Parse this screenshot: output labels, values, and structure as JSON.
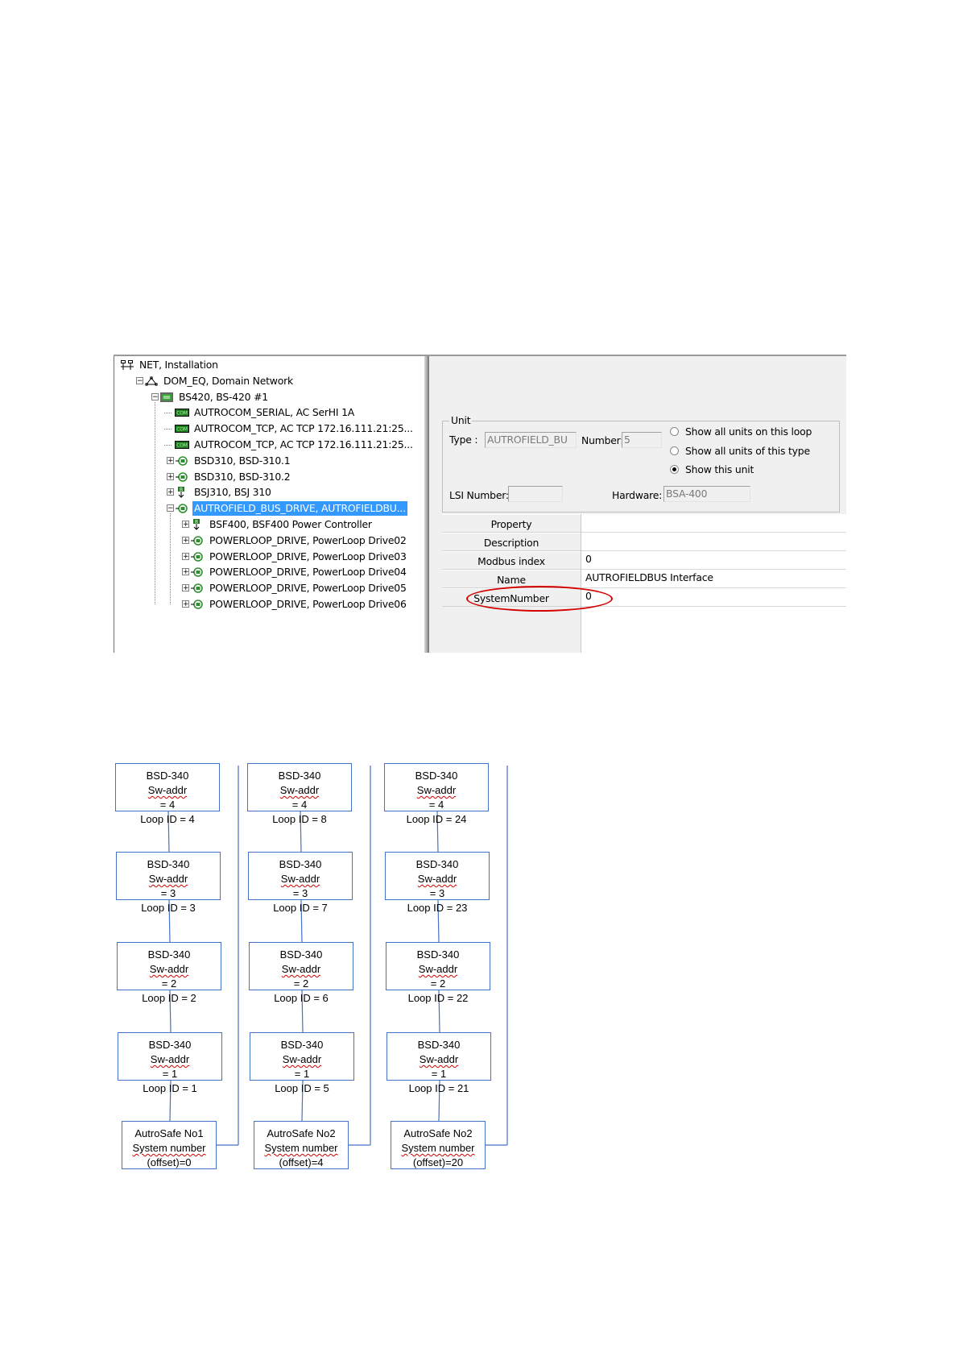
{
  "tree": {
    "items": [
      {
        "label": "NET, Installation",
        "icon": "network-icon"
      },
      {
        "label": "DOM_EQ, Domain Network",
        "icon": "domain-icon"
      },
      {
        "label": "BS420, BS-420 #1",
        "icon": "controller-icon"
      },
      {
        "label": "AUTROCOM_SERIAL, AC SerHI 1A",
        "icon": "com-icon",
        "badge": "COM"
      },
      {
        "label": "AUTROCOM_TCP, AC TCP 172.16.111.21:25...",
        "icon": "com-icon",
        "badge": "COM"
      },
      {
        "label": "AUTROCOM_TCP, AC TCP 172.16.111.21:25...",
        "icon": "com-icon",
        "badge": "COM"
      },
      {
        "label": "BSD310, BSD-310.1",
        "icon": "loop-driver-icon"
      },
      {
        "label": "BSD310, BSD-310.2",
        "icon": "loop-driver-icon"
      },
      {
        "label": "BSJ310, BSJ 310",
        "icon": "bus-icon",
        "badge": "B"
      },
      {
        "label": "AUTROFIELD_BUS_DRIVE, AUTROFIELDBU...",
        "icon": "loop-driver-icon",
        "selected": true
      },
      {
        "label": "BSF400, BSF400 Power Controller",
        "icon": "bus-icon",
        "badge": "B"
      },
      {
        "label": "POWERLOOP_DRIVE, PowerLoop Drive02",
        "icon": "loop-driver-icon"
      },
      {
        "label": "POWERLOOP_DRIVE, PowerLoop Drive03",
        "icon": "loop-driver-icon"
      },
      {
        "label": "POWERLOOP_DRIVE, PowerLoop Drive04",
        "icon": "loop-driver-icon"
      },
      {
        "label": "POWERLOOP_DRIVE, PowerLoop Drive05",
        "icon": "loop-driver-icon"
      },
      {
        "label": "POWERLOOP_DRIVE, PowerLoop Drive06",
        "icon": "loop-driver-icon"
      }
    ],
    "colors": {
      "selected_bg": "#3399ff",
      "com_icon": "#1f7a1f"
    }
  },
  "unit": {
    "group_label": "Unit",
    "type_label": "Type :",
    "type_value": "AUTROFIELD_BU",
    "number_label": "Number:",
    "number_value": "5",
    "lsi_label": "LSI Number:",
    "lsi_value": "",
    "hardware_label": "Hardware:",
    "hardware_value": "BSA-400",
    "radios": [
      {
        "label": "Show all units on this loop",
        "checked": false
      },
      {
        "label": "Show all units of this type",
        "checked": false
      },
      {
        "label": "Show this unit",
        "checked": true
      }
    ]
  },
  "properties": {
    "header": "Property",
    "rows": [
      {
        "name": "Description",
        "value": ""
      },
      {
        "name": "Modbus index",
        "value": "0"
      },
      {
        "name": "Name",
        "value": "AUTROFIELDBUS Interface"
      },
      {
        "name": "SystemNumber",
        "value": "0",
        "highlighted": true
      }
    ],
    "highlight_color": "#d40000"
  },
  "diagram": {
    "line_color": "#4472c4",
    "columns": [
      {
        "nodes": [
          {
            "title": "BSD-340",
            "addr_key": "Sw-addr",
            "addr_val": " = 4",
            "loop": "Loop ID = 4"
          },
          {
            "title": "BSD-340",
            "addr_key": "Sw-addr",
            "addr_val": " = 3",
            "loop": "Loop ID = 3"
          },
          {
            "title": "BSD-340",
            "addr_key": "Sw-addr",
            "addr_val": " = 2",
            "loop": "Loop ID = 2"
          },
          {
            "title": "BSD-340",
            "addr_key": "Sw-addr",
            "addr_val": " = 1",
            "loop": "Loop ID = 1"
          }
        ],
        "panel": {
          "line1": "AutroSafe No1",
          "line2": "System number",
          "line3": "(offset)=0"
        }
      },
      {
        "nodes": [
          {
            "title": "BSD-340",
            "addr_key": "Sw-addr",
            "addr_val": " = 4",
            "loop": "Loop ID = 8"
          },
          {
            "title": "BSD-340",
            "addr_key": "Sw-addr",
            "addr_val": " = 3",
            "loop": "Loop ID = 7"
          },
          {
            "title": "BSD-340",
            "addr_key": "Sw-addr",
            "addr_val": " = 2",
            "loop": "Loop ID = 6"
          },
          {
            "title": "BSD-340",
            "addr_key": "Sw-addr",
            "addr_val": " = 1",
            "loop": "Loop ID = 5"
          }
        ],
        "panel": {
          "line1": "AutroSafe No2",
          "line2": "System number",
          "line3": "(offset)=4"
        }
      },
      {
        "nodes": [
          {
            "title": "BSD-340",
            "addr_key": "Sw-addr",
            "addr_val": " = 4",
            "loop": "Loop ID = 24"
          },
          {
            "title": "BSD-340",
            "addr_key": "Sw-addr",
            "addr_val": " = 3",
            "loop": "Loop ID = 23"
          },
          {
            "title": "BSD-340",
            "addr_key": "Sw-addr",
            "addr_val": " = 2",
            "loop": "Loop ID = 22"
          },
          {
            "title": "BSD-340",
            "addr_key": "Sw-addr",
            "addr_val": " = 1",
            "loop": "Loop ID = 21"
          }
        ],
        "panel": {
          "line1": "AutroSafe No2",
          "line2": "System number",
          "line3": "(offset)=20"
        }
      }
    ]
  }
}
